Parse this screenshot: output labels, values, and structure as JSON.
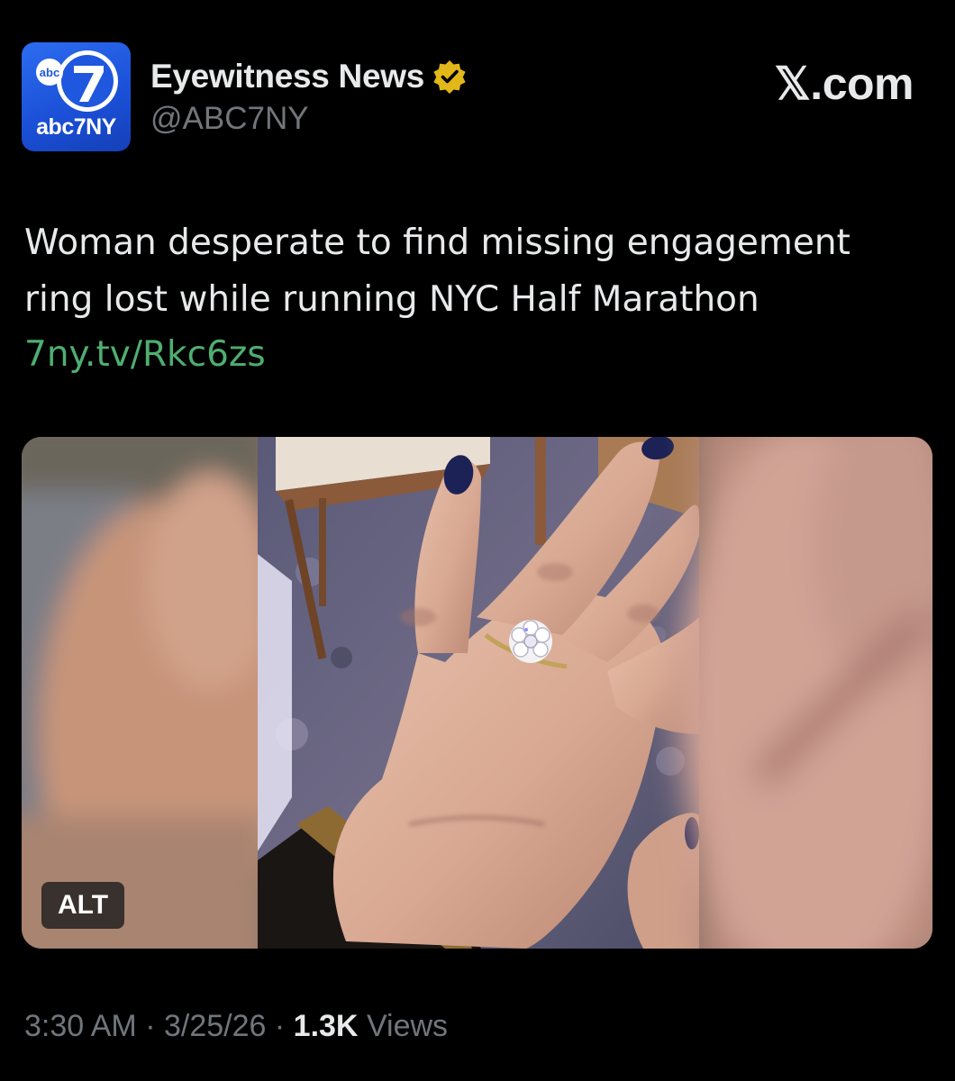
{
  "author": {
    "display_name": "Eyewitness News",
    "handle": "@ABC7NY",
    "verified": true,
    "avatar": {
      "logo_small_text": "abc",
      "logo_number": "7",
      "logo_brand": "abc7NY",
      "background_color": "#1f57de"
    }
  },
  "site_mark": "𝕏.com",
  "post": {
    "text": "Woman desperate to find missing engagement ring lost while running NYC Half Marathon",
    "link_text": "7ny.tv/Rkc6zs",
    "link_color": "#4fae70"
  },
  "media": {
    "alt_badge_label": "ALT"
  },
  "footer": {
    "time": "3:30 AM",
    "separator": "·",
    "date": "3/25/26",
    "views_count": "1.3K",
    "views_label": "Views"
  },
  "colors": {
    "background": "#000000",
    "primary_text": "#e7e9ea",
    "secondary_text": "#71767b",
    "verified_badge": "#e2b719"
  }
}
